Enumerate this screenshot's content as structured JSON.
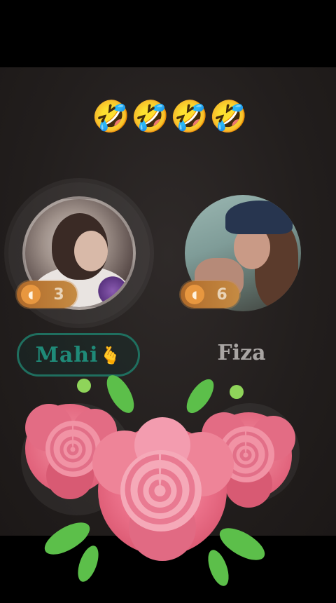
{
  "reaction": {
    "emojis": [
      "🤣",
      "🤣",
      "🤣",
      "🤣"
    ]
  },
  "seats": [
    {
      "badge_count": "3",
      "name": "Mahi",
      "name_emoji": "🫰"
    },
    {
      "badge_count": "6",
      "name": "Fiza"
    }
  ],
  "gift": {
    "icon": "rose-bouquet",
    "colors": {
      "rose": "#ea6f88",
      "leaf": "#5cbf4a"
    }
  }
}
